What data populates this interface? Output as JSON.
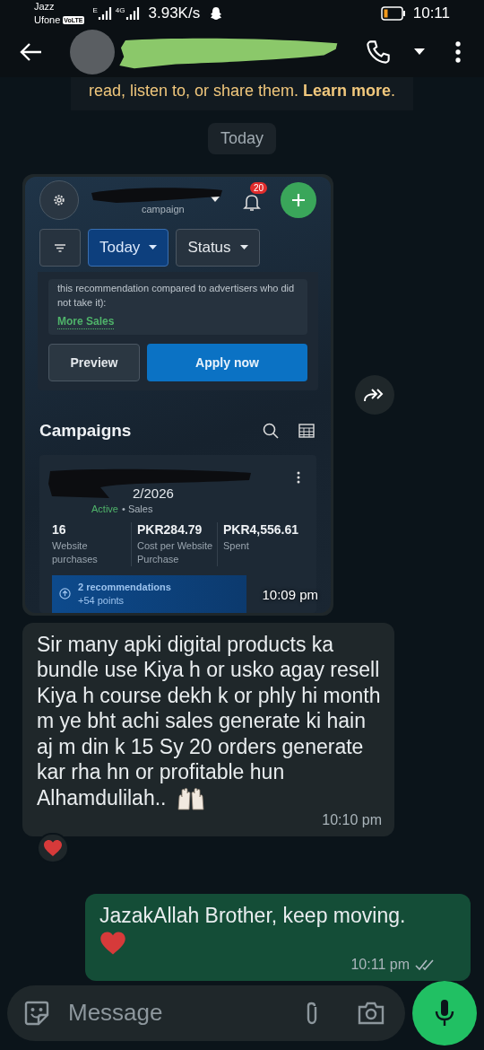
{
  "status_bar": {
    "carrier_1": "Jazz",
    "carrier_2": "Ufone",
    "volte": "VoLTE",
    "network_1": "E",
    "network_2": "4G",
    "speed": "3.93K/s",
    "time": "10:11"
  },
  "notice": {
    "text": "read, listen to, or share them.",
    "link": "Learn more",
    "after": "."
  },
  "date_chip": "Today",
  "messages": [
    {
      "kind": "image",
      "outgoing": false,
      "time": "10:09 pm",
      "reacted": false,
      "screen": {
        "subtitle": "campaign",
        "notification_count": "20",
        "filters": [
          {
            "label": "Today",
            "selected": true
          },
          {
            "label": "Status",
            "selected": false
          }
        ],
        "recommendation_text": "this recommendation compared to advertisers who did not take it):",
        "recommendation_link": "More Sales",
        "buttons": [
          {
            "label": "Preview",
            "kind": "secondary"
          },
          {
            "label": "Apply now",
            "kind": "primary"
          }
        ],
        "section_title": "Campaigns",
        "campaign_date": "2/2026",
        "campaign_status": "Active",
        "separator": "•",
        "campaign_objective": "Sales",
        "metrics": [
          {
            "value": "16",
            "label": "Website purchases"
          },
          {
            "value": "PKR284.79",
            "label": "Cost per Website Purchase"
          },
          {
            "value": "PKR4,556.61",
            "label": "Spent"
          }
        ],
        "recommendations": "2 recommendations",
        "points": "+54 points"
      }
    },
    {
      "kind": "text",
      "outgoing": false,
      "text": "Sir many apki digital products ka bundle use Kiya h or usko agay resell Kiya h course dekh k or phly hi month m ye bht achi sales generate ki hain aj m din k 15 Sy 20 orders generate kar rha hn or profitable hun Alhamdulilah..",
      "trailing_emoji": {
        "kind": "raised-hands"
      },
      "time": "10:10 pm",
      "reacted": true
    },
    {
      "kind": "text",
      "outgoing": true,
      "text": "JazakAllah Brother, keep moving.",
      "trailing_emoji": {
        "kind": "heart"
      },
      "time": "10:11 pm",
      "read": false,
      "reacted": false
    }
  ],
  "composer": {
    "placeholder": "Message"
  }
}
